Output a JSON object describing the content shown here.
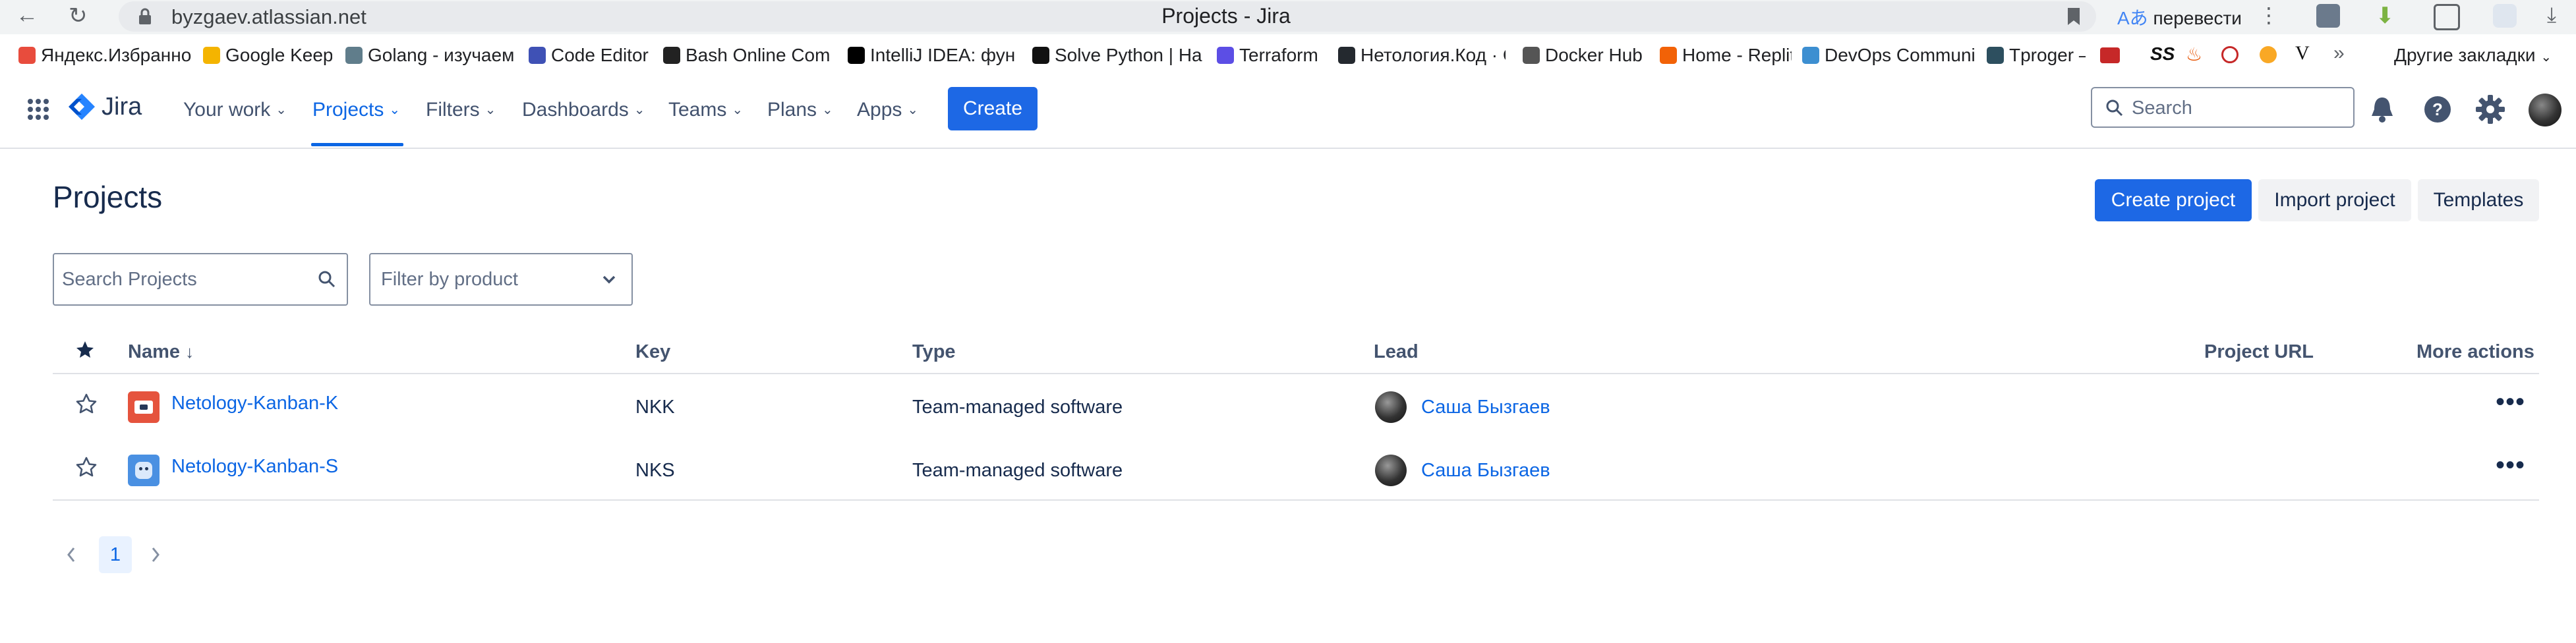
{
  "browser": {
    "url": "byzgaev.atlassian.net",
    "tab_title": "Projects - Jira",
    "translate_label": "перевести",
    "bookmarks": [
      {
        "label": "Яндекс.Избранно",
        "color": "#e84c3d"
      },
      {
        "label": "Google Keep",
        "color": "#f4b400"
      },
      {
        "label": "Golang - изучаем",
        "color": "#607d8b"
      },
      {
        "label": "Code Editor",
        "color": "#3f51b5"
      },
      {
        "label": "Bash Online Comp",
        "color": "#222222"
      },
      {
        "label": "IntelliJ IDEA: функ",
        "color": "#000000"
      },
      {
        "label": "Solve Python | Hac",
        "color": "#111111"
      },
      {
        "label": "Terraform",
        "color": "#5c4ee5"
      },
      {
        "label": "Нетология.Код · G",
        "color": "#24292f"
      },
      {
        "label": "Docker Hub",
        "color": "#555555"
      },
      {
        "label": "Home - Replit",
        "color": "#f26207"
      },
      {
        "label": "DevOps Communi",
        "color": "#3d8fd1"
      },
      {
        "label": "Tproger –",
        "color": "#2d4f5f"
      }
    ],
    "other_bookmarks": "Другие закладки"
  },
  "topnav": {
    "logo": "Jira",
    "items": [
      "Your work",
      "Projects",
      "Filters",
      "Dashboards",
      "Teams",
      "Plans",
      "Apps"
    ],
    "active": "Projects",
    "create": "Create",
    "search_placeholder": "Search"
  },
  "page": {
    "title": "Projects",
    "create_project": "Create project",
    "import_project": "Import project",
    "templates": "Templates",
    "search_placeholder": "Search Projects",
    "filter_placeholder": "Filter by product"
  },
  "table": {
    "headers": {
      "name": "Name",
      "key": "Key",
      "type": "Type",
      "lead": "Lead",
      "url": "Project URL",
      "actions": "More actions"
    },
    "rows": [
      {
        "name": "Netology-Kanban-K",
        "key": "NKK",
        "type": "Team-managed software",
        "lead": "Саша Бызгаев",
        "icon_color": "#e5533d"
      },
      {
        "name": "Netology-Kanban-S",
        "key": "NKS",
        "type": "Team-managed software",
        "lead": "Саша Бызгаев",
        "icon_color": "#4a90e2"
      }
    ]
  },
  "pagination": {
    "current": "1"
  },
  "colors": {
    "brand": "#0c66e4",
    "primary_button": "#1d68e5"
  }
}
